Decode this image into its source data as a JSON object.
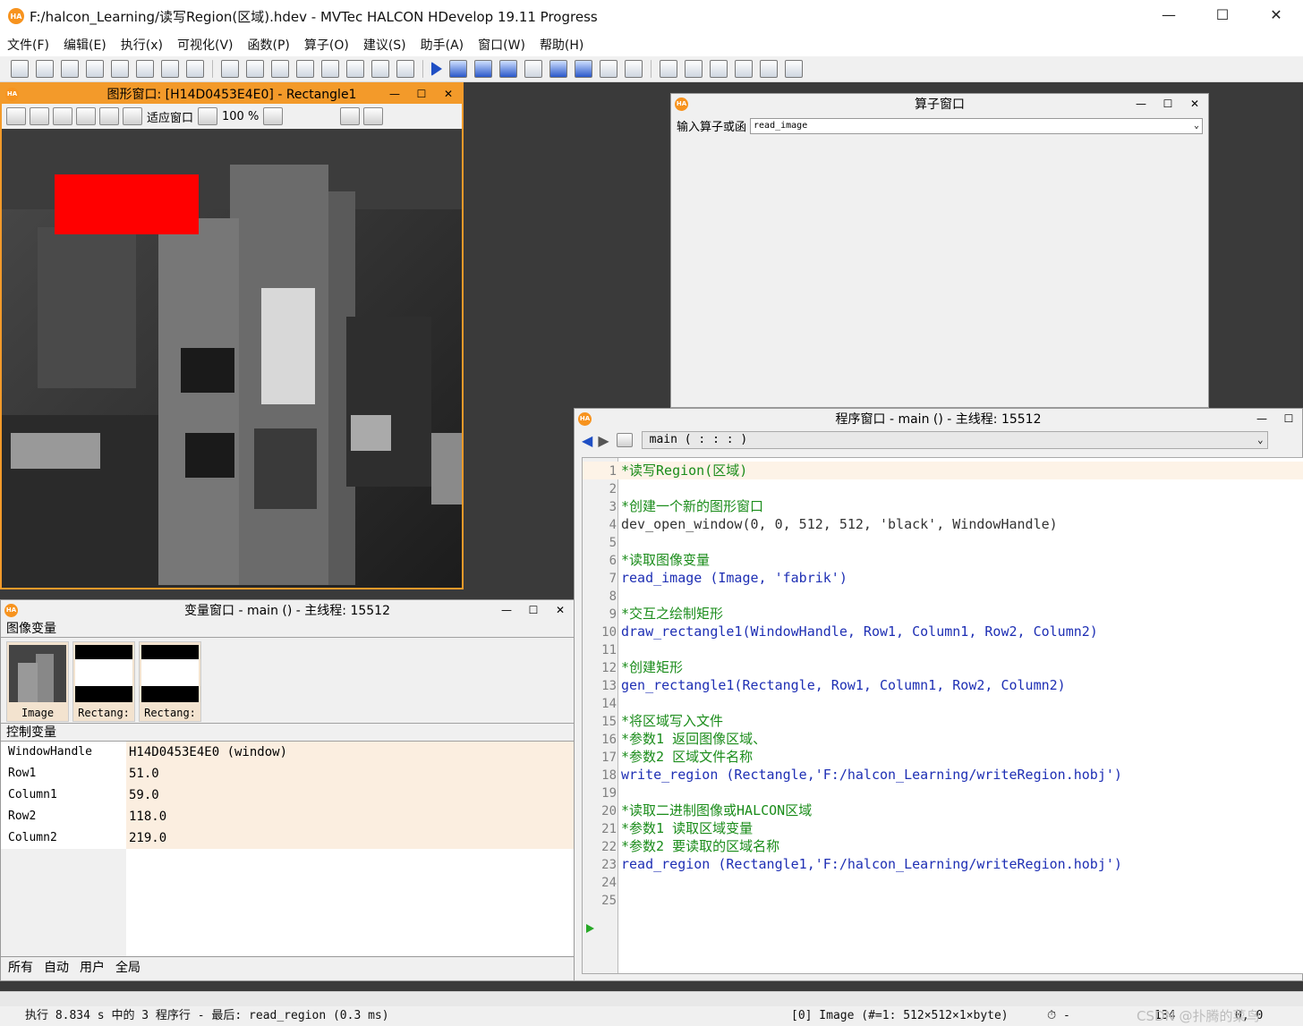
{
  "app": {
    "title": "F:/halcon_Learning/读写Region(区域).hdev - MVTec HALCON HDevelop 19.11 Progress",
    "logo": "HA",
    "window_controls": [
      "—",
      "☐",
      "✕"
    ]
  },
  "menu": [
    "文件(F)",
    "编辑(E)",
    "执行(x)",
    "可视化(V)",
    "函数(P)",
    "算子(O)",
    "建议(S)",
    "助手(A)",
    "窗口(W)",
    "帮助(H)"
  ],
  "graphics_window": {
    "title": "图形窗口: [H14D0453E4E0] - Rectangle1",
    "fit_label": "适应窗口",
    "zoom_label": "100 %",
    "region_color": "#ff0000",
    "region": {
      "row1": 51.0,
      "column1": 59.0,
      "row2": 118.0,
      "column2": 219.0
    }
  },
  "operator_window": {
    "title": "算子窗口",
    "label": "输入算子或函",
    "input_value": "read_image"
  },
  "variable_window": {
    "title": "变量窗口 - main () - 主线程: 15512",
    "image_section": "图像变量",
    "images": [
      "Image",
      "Rectang:",
      "Rectang:"
    ],
    "control_section": "控制变量",
    "controls": [
      {
        "name": "WindowHandle",
        "value": "H14D0453E4E0 (window)"
      },
      {
        "name": "Row1",
        "value": "51.0"
      },
      {
        "name": "Column1",
        "value": "59.0"
      },
      {
        "name": "Row2",
        "value": "118.0"
      },
      {
        "name": "Column2",
        "value": "219.0"
      }
    ],
    "tabs": [
      "所有",
      "自动",
      "用户",
      "全局"
    ]
  },
  "program_window": {
    "title": "程序窗口 - main () - 主线程: 15512",
    "procedure": "main ( : : : )",
    "lines": [
      {
        "n": "1",
        "text": "*读写Region(区域)",
        "type": "comment"
      },
      {
        "n": "2",
        "text": "",
        "type": "blank"
      },
      {
        "n": "3",
        "text": "*创建一个新的图形窗口",
        "type": "comment"
      },
      {
        "n": "4",
        "text": "dev_open_window(0, 0, 512, 512, 'black', WindowHandle)",
        "type": "code-dark"
      },
      {
        "n": "5",
        "text": "",
        "type": "blank"
      },
      {
        "n": "6",
        "text": "*读取图像变量",
        "type": "comment"
      },
      {
        "n": "7",
        "text": "read_image (Image, 'fabrik')",
        "type": "code"
      },
      {
        "n": "8",
        "text": "",
        "type": "blank"
      },
      {
        "n": "9",
        "text": "*交互之绘制矩形",
        "type": "comment"
      },
      {
        "n": "10",
        "text": "draw_rectangle1(WindowHandle, Row1, Column1, Row2, Column2)",
        "type": "code"
      },
      {
        "n": "11",
        "text": "",
        "type": "blank"
      },
      {
        "n": "12",
        "text": "*创建矩形",
        "type": "comment"
      },
      {
        "n": "13",
        "text": "gen_rectangle1(Rectangle, Row1, Column1, Row2, Column2)",
        "type": "code"
      },
      {
        "n": "14",
        "text": "",
        "type": "blank"
      },
      {
        "n": "15",
        "text": "*将区域写入文件",
        "type": "comment"
      },
      {
        "n": "16",
        "text": "*参数1 返回图像区域、",
        "type": "comment"
      },
      {
        "n": "17",
        "text": "*参数2 区域文件名称",
        "type": "comment"
      },
      {
        "n": "18",
        "text": "write_region (Rectangle,'F:/halcon_Learning/writeRegion.hobj')",
        "type": "code"
      },
      {
        "n": "19",
        "text": "",
        "type": "blank"
      },
      {
        "n": "20",
        "text": "*读取二进制图像或HALCON区域",
        "type": "comment"
      },
      {
        "n": "21",
        "text": "*参数1 读取区域变量",
        "type": "comment"
      },
      {
        "n": "22",
        "text": "*参数2 要读取的区域名称",
        "type": "comment"
      },
      {
        "n": "23",
        "text": "read_region (Rectangle1,'F:/halcon_Learning/writeRegion.hobj')",
        "type": "code"
      },
      {
        "n": "24",
        "text": "",
        "type": "blank"
      },
      {
        "n": "25",
        "text": "",
        "type": "blank"
      }
    ]
  },
  "status": {
    "message": "执行 8.834 s 中的 3 程序行 - 最后: read_region (0.3 ms)",
    "image_info": "[0] Image (#=1: 512×512×1×byte)",
    "timer": "⏱ -",
    "gray": "134",
    "coords": "0, 0",
    "watermark": "CSDN @扑腾的菜鸟"
  }
}
